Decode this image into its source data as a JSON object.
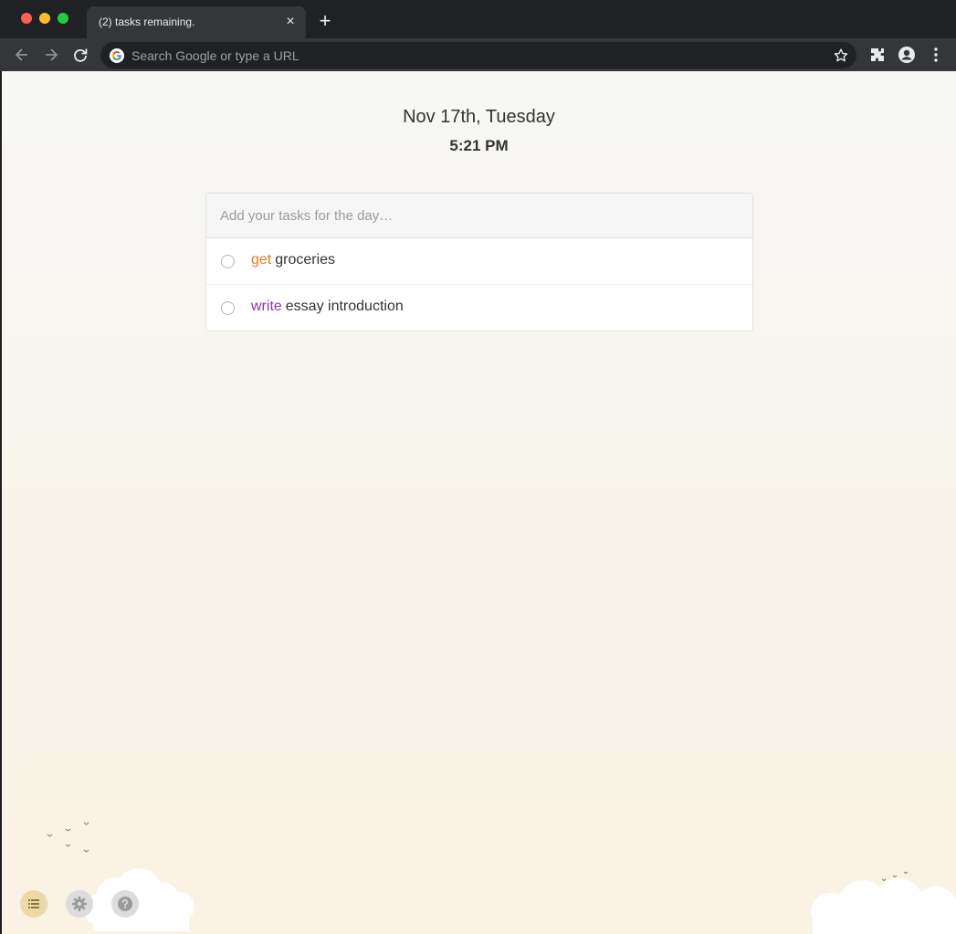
{
  "browser": {
    "tab_title": "(2) tasks remaining.",
    "tab_close": "×",
    "new_tab": "+",
    "omnibox_placeholder": "Search Google or type a URL"
  },
  "header": {
    "date": "Nov 17th, Tuesday",
    "time": "5:21 PM"
  },
  "task_input": {
    "placeholder": "Add your tasks for the day…",
    "value": ""
  },
  "tasks": [
    {
      "verb": "get",
      "rest": "groceries",
      "verb_color": "#e07b1a",
      "done": false
    },
    {
      "verb": "write",
      "rest": "essay introduction",
      "verb_color": "#8b3aa8",
      "done": false
    }
  ],
  "footer": {
    "buttons": [
      "list-icon",
      "gear-icon",
      "help-icon"
    ]
  },
  "colors": {
    "get_verb": "#e07b1a",
    "write_verb": "#8b3aa8"
  }
}
